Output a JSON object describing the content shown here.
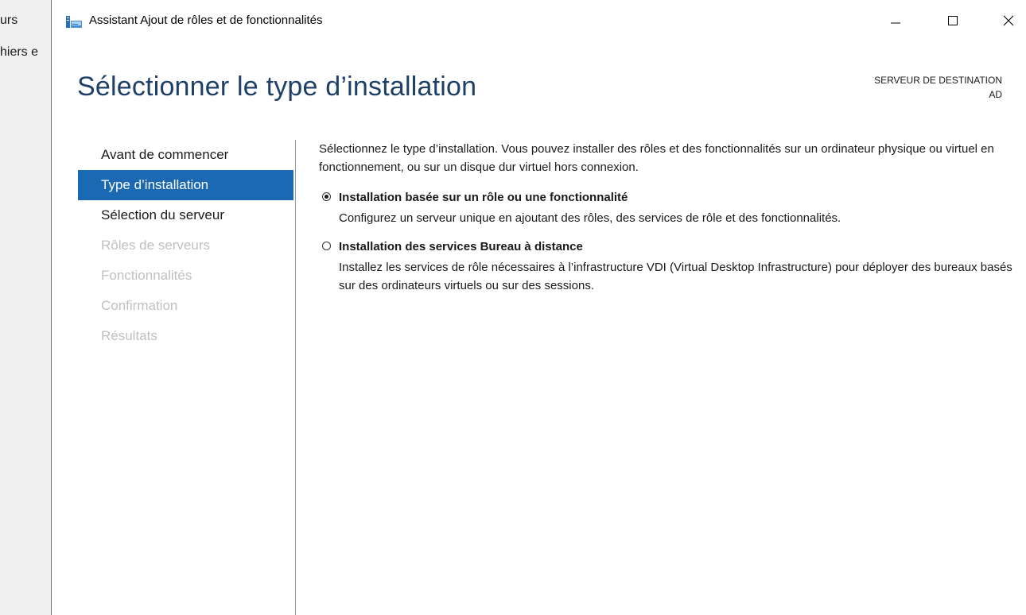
{
  "backdrop": {
    "lines": [
      "urs",
      "hiers e"
    ]
  },
  "window": {
    "title": "Assistant Ajout de rôles et de fonctionnalités",
    "icon": "server-manager-wizard-icon",
    "controls": {
      "minimize": "minimize-icon",
      "maximize": "maximize-icon",
      "close": "close-icon"
    }
  },
  "header": {
    "page_title": "Sélectionner le type d’installation",
    "destination_label": "SERVEUR DE DESTINATION",
    "destination_server": "AD"
  },
  "nav": {
    "items": [
      {
        "label": "Avant de commencer",
        "state": "done"
      },
      {
        "label": "Type d’installation",
        "state": "active"
      },
      {
        "label": "Sélection du serveur",
        "state": "done"
      },
      {
        "label": "Rôles de serveurs",
        "state": "disabled"
      },
      {
        "label": "Fonctionnalités",
        "state": "disabled"
      },
      {
        "label": "Confirmation",
        "state": "disabled"
      },
      {
        "label": "Résultats",
        "state": "disabled"
      }
    ]
  },
  "content": {
    "intro": "Sélectionnez le type d’installation. Vous pouvez installer des rôles et des fonctionnalités sur un ordinateur physique ou virtuel en fonctionnement, ou sur un disque dur virtuel hors connexion.",
    "options": [
      {
        "title": "Installation basée sur un rôle ou une fonctionnalité",
        "description": "Configurez un serveur unique en ajoutant des rôles, des services de rôle et des fonctionnalités.",
        "selected": true
      },
      {
        "title": "Installation des services Bureau à distance",
        "description": "Installez les services de rôle nécessaires à l’infrastructure VDI (Virtual Desktop Infrastructure) pour déployer des bureaux basés sur des ordinateurs virtuels ou sur des sessions.",
        "selected": false
      }
    ]
  },
  "colors": {
    "accent": "#1c69b3",
    "title_text": "#1e3f66",
    "disabled_text": "#c0c0c0"
  }
}
